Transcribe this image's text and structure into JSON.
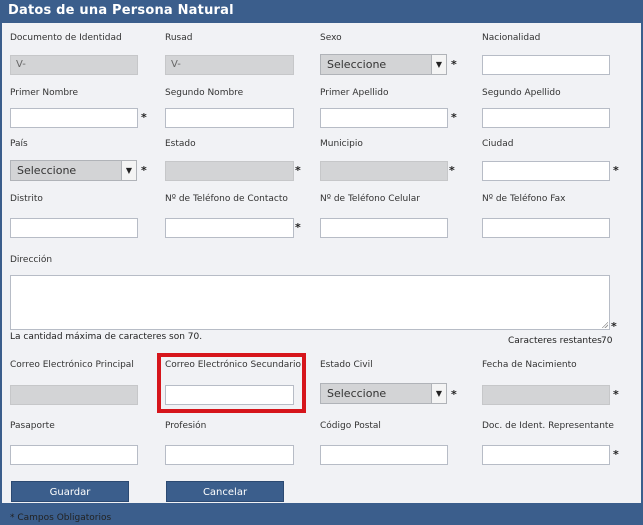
{
  "title": "Datos de una Persona Natural",
  "fields": {
    "documento": {
      "label": "Documento de Identidad",
      "value": "V-"
    },
    "rusad": {
      "label": "Rusad",
      "value": "V-"
    },
    "sexo": {
      "label": "Sexo",
      "value": "Seleccione"
    },
    "nacionalidad": {
      "label": "Nacionalidad",
      "value": ""
    },
    "primer_nombre": {
      "label": "Primer Nombre",
      "value": ""
    },
    "segundo_nombre": {
      "label": "Segundo Nombre",
      "value": ""
    },
    "primer_apellido": {
      "label": "Primer Apellido",
      "value": ""
    },
    "segundo_apellido": {
      "label": "Segundo Apellido",
      "value": ""
    },
    "pais": {
      "label": "País",
      "value": "Seleccione"
    },
    "estado": {
      "label": "Estado",
      "value": ""
    },
    "municipio": {
      "label": "Municipio",
      "value": ""
    },
    "ciudad": {
      "label": "Ciudad",
      "value": ""
    },
    "distrito": {
      "label": "Distrito",
      "value": ""
    },
    "tel_contacto": {
      "label": "Nº de Teléfono de Contacto",
      "value": ""
    },
    "tel_celular": {
      "label": "Nº de Teléfono Celular",
      "value": ""
    },
    "tel_fax": {
      "label": "Nº de Teléfono Fax",
      "value": ""
    },
    "direccion": {
      "label": "Dirección",
      "value": ""
    },
    "correo_principal": {
      "label": "Correo Electrónico Principal",
      "value": ""
    },
    "correo_secundario": {
      "label": "Correo Electrónico Secundario",
      "value": ""
    },
    "estado_civil": {
      "label": "Estado Civil",
      "value": "Seleccione"
    },
    "fecha_nacimiento": {
      "label": "Fecha de Nacimiento",
      "value": ""
    },
    "pasaporte": {
      "label": "Pasaporte",
      "value": ""
    },
    "profesion": {
      "label": "Profesión",
      "value": ""
    },
    "codigo_postal": {
      "label": "Código Postal",
      "value": ""
    },
    "doc_representante": {
      "label": "Doc. de Ident. Representante",
      "value": ""
    }
  },
  "direccion_note": "La cantidad máxima de caracteres son 70.",
  "chars_remaining_label": "Caracteres restantes",
  "chars_remaining_value": "70",
  "required_mark": "*",
  "buttons": {
    "guardar": "Guardar",
    "cancelar": "Cancelar"
  },
  "footer_note": "* Campos Obligatorios",
  "dropdown_arrow": "▼",
  "colors": {
    "header": "#3b5e8c",
    "highlight": "#d6151b"
  }
}
